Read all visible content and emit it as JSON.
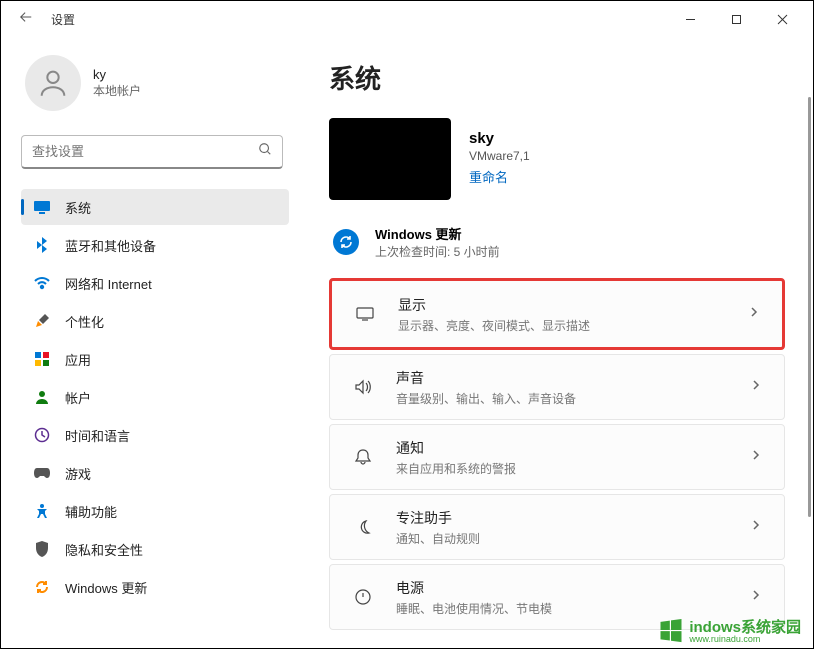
{
  "app": {
    "title": "设置"
  },
  "user": {
    "name": "ky",
    "subtitle": "本地帐户"
  },
  "search": {
    "placeholder": "查找设置"
  },
  "nav": {
    "items": [
      {
        "label": "系统",
        "active": true,
        "icon": "system"
      },
      {
        "label": "蓝牙和其他设备",
        "active": false,
        "icon": "bluetooth"
      },
      {
        "label": "网络和 Internet",
        "active": false,
        "icon": "wifi"
      },
      {
        "label": "个性化",
        "active": false,
        "icon": "personalize"
      },
      {
        "label": "应用",
        "active": false,
        "icon": "apps"
      },
      {
        "label": "帐户",
        "active": false,
        "icon": "account"
      },
      {
        "label": "时间和语言",
        "active": false,
        "icon": "time"
      },
      {
        "label": "游戏",
        "active": false,
        "icon": "gaming"
      },
      {
        "label": "辅助功能",
        "active": false,
        "icon": "access"
      },
      {
        "label": "隐私和安全性",
        "active": false,
        "icon": "privacy"
      },
      {
        "label": "Windows 更新",
        "active": false,
        "icon": "update"
      }
    ]
  },
  "page": {
    "title": "系统",
    "device": {
      "name": "sky",
      "model": "VMware7,1",
      "rename_link": "重命名"
    },
    "update": {
      "title": "Windows 更新",
      "subtitle": "上次检查时间: 5 小时前"
    },
    "cards": [
      {
        "title": "显示",
        "subtitle": "显示器、亮度、夜间模式、显示描述",
        "highlight": true
      },
      {
        "title": "声音",
        "subtitle": "音量级别、输出、输入、声音设备",
        "highlight": false
      },
      {
        "title": "通知",
        "subtitle": "来自应用和系统的警报",
        "highlight": false
      },
      {
        "title": "专注助手",
        "subtitle": "通知、自动规则",
        "highlight": false
      },
      {
        "title": "电源",
        "subtitle": "睡眠、电池使用情况、节电模",
        "highlight": false
      }
    ]
  },
  "watermark": {
    "main": "indows系统家园",
    "sub": "www.ruinadu.com"
  }
}
